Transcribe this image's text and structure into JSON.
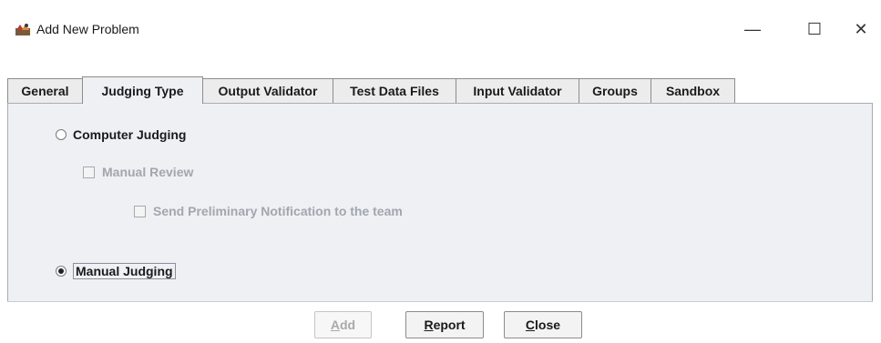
{
  "window": {
    "title": "Add New Problem",
    "icon": "app-window-icon",
    "controls": {
      "minimize": "—",
      "maximize": "☐",
      "close": "✕"
    }
  },
  "tabs": [
    {
      "label": "General",
      "selected": false
    },
    {
      "label": "Judging Type",
      "selected": true
    },
    {
      "label": "Output Validator",
      "selected": false
    },
    {
      "label": "Test Data Files",
      "selected": false
    },
    {
      "label": "Input Validator",
      "selected": false
    },
    {
      "label": "Groups",
      "selected": false
    },
    {
      "label": "Sandbox",
      "selected": false
    }
  ],
  "judging": {
    "computer_judging": {
      "label": "Computer Judging",
      "checked": false
    },
    "manual_review": {
      "label": "Manual Review",
      "checked": false,
      "enabled": false
    },
    "send_preliminary": {
      "label": "Send Preliminary Notification to the team",
      "checked": false,
      "enabled": false
    },
    "manual_judging": {
      "label": "Manual Judging",
      "checked": true
    }
  },
  "buttons": {
    "add": {
      "mnemonic": "A",
      "rest": "dd",
      "enabled": false
    },
    "report": {
      "mnemonic": "R",
      "rest": "eport",
      "enabled": true
    },
    "close": {
      "mnemonic": "C",
      "rest": "lose",
      "enabled": true
    }
  },
  "colors": {
    "panel_bg": "#eef0f4",
    "disabled_text": "#a2a6ad"
  }
}
